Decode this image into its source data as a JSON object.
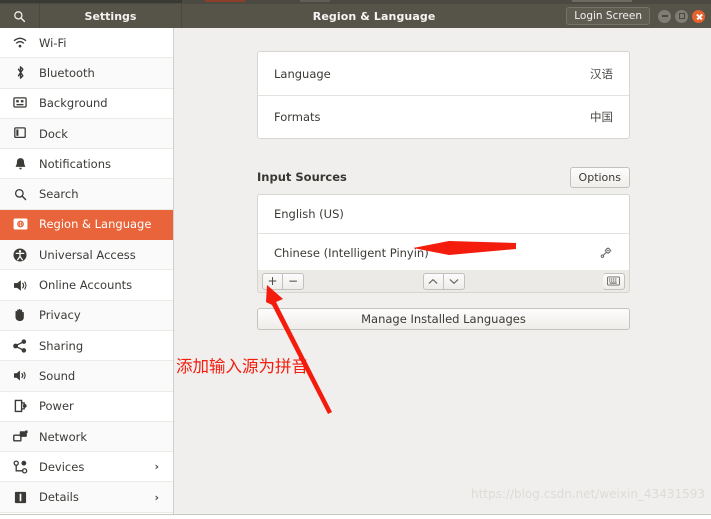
{
  "window": {
    "search_icon": "search-icon",
    "settings_label": "Settings",
    "title": "Region & Language",
    "login_screen_label": "Login Screen",
    "controls": {
      "minimize": "minimize-button",
      "maximize": "maximize-button",
      "close": "close-button"
    },
    "accent_color": "#e9643b",
    "titlebar_color": "#565449"
  },
  "sidebar": {
    "items": [
      {
        "label": "Wi-Fi",
        "icon": "wifi-icon",
        "active": false,
        "chevron": ""
      },
      {
        "label": "Bluetooth",
        "icon": "bluetooth-icon",
        "active": false,
        "chevron": ""
      },
      {
        "label": "Background",
        "icon": "background-icon",
        "active": false,
        "chevron": ""
      },
      {
        "label": "Dock",
        "icon": "dock-icon",
        "active": false,
        "chevron": ""
      },
      {
        "label": "Notifications",
        "icon": "bell-icon",
        "active": false,
        "chevron": ""
      },
      {
        "label": "Search",
        "icon": "search-icon",
        "active": false,
        "chevron": ""
      },
      {
        "label": "Region & Language",
        "icon": "region-language-icon",
        "active": true,
        "chevron": ""
      },
      {
        "label": "Universal Access",
        "icon": "universal-access-icon",
        "active": false,
        "chevron": ""
      },
      {
        "label": "Online Accounts",
        "icon": "online-accounts-icon",
        "active": false,
        "chevron": ""
      },
      {
        "label": "Privacy",
        "icon": "privacy-hand-icon",
        "active": false,
        "chevron": ""
      },
      {
        "label": "Sharing",
        "icon": "sharing-icon",
        "active": false,
        "chevron": ""
      },
      {
        "label": "Sound",
        "icon": "sound-icon",
        "active": false,
        "chevron": ""
      },
      {
        "label": "Power",
        "icon": "power-icon",
        "active": false,
        "chevron": ""
      },
      {
        "label": "Network",
        "icon": "network-icon",
        "active": false,
        "chevron": ""
      },
      {
        "label": "Devices",
        "icon": "devices-icon",
        "active": false,
        "chevron": "›"
      },
      {
        "label": "Details",
        "icon": "details-icon",
        "active": false,
        "chevron": "›"
      }
    ]
  },
  "main": {
    "language_card": [
      {
        "label": "Language",
        "value": "汉语"
      },
      {
        "label": "Formats",
        "value": "中国"
      }
    ],
    "input_sources": {
      "section_title": "Input Sources",
      "options_label": "Options",
      "items": [
        {
          "label": "English (US)",
          "has_gear": false
        },
        {
          "label": "Chinese (Intelligent Pinyin)",
          "has_gear": true
        }
      ],
      "toolbar": {
        "add_label": "+",
        "remove_label": "−",
        "move_up_label": "⌃",
        "move_down_label": "⌄",
        "keyboard_label": "keyboard-icon"
      }
    },
    "manage_button_label": "Manage Installed Languages"
  },
  "annotations": {
    "note_text": "添加输入源为拼音",
    "note_color": "#f41c0c",
    "arrow_to_pinyin": "arrow-pointing-to-chinese-input-source",
    "arrow_to_add": "arrow-pointing-to-add-button"
  },
  "watermark": {
    "text": "https://blog.csdn.net/weixin_43431593"
  }
}
